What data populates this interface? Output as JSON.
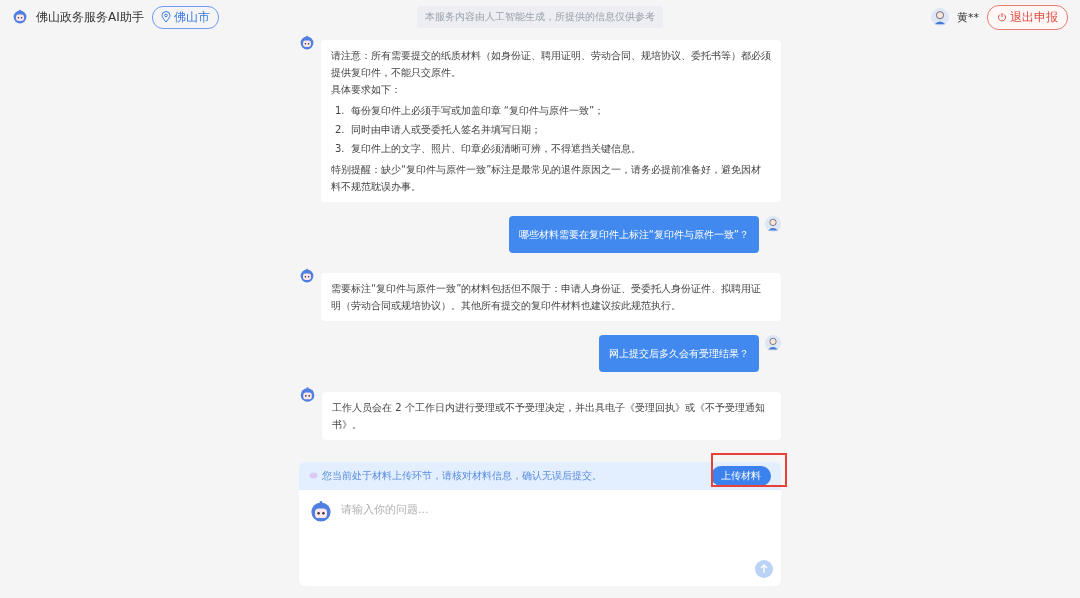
{
  "header": {
    "title": "佛山政务服务AI助手",
    "location": "佛山市",
    "notice": "本服务内容由人工智能生成，所提供的信息仅供参考",
    "user_name": "黄**",
    "exit_button": "退出申报"
  },
  "messages": [
    {
      "kind": "bot",
      "blocks": [
        {
          "kind": "text",
          "text": "请注意：所有需要提交的纸质材料（如身份证、聘用证明、劳动合同、规培协议、委托书等）都必须提供复印件，不能只交原件。"
        },
        {
          "kind": "text",
          "text": "具体要求如下："
        },
        {
          "kind": "list",
          "items": [
            {
              "marker": "1.",
              "text": "每份复印件上必须手写或加盖印章 “复印件与原件一致”；"
            },
            {
              "marker": "2.",
              "text": "同时由申请人或受委托人签名并填写日期；"
            },
            {
              "marker": "3.",
              "text": "复印件上的文字、照片、印章必须清晰可辨，不得遮挡关键信息。"
            }
          ]
        },
        {
          "kind": "text",
          "text": "特别提醒：缺少“复印件与原件一致”标注是最常见的退件原因之一，请务必提前准备好，避免因材料不规范耽误办事。"
        }
      ]
    },
    {
      "kind": "user",
      "blocks": [
        {
          "kind": "text",
          "text": "哪些材料需要在复印件上标注“复印件与原件一致”？"
        }
      ]
    },
    {
      "kind": "bot",
      "blocks": [
        {
          "kind": "text",
          "text": "需要标注“复印件与原件一致”的材料包括但不限于：申请人身份证、受委托人身份证件、拟聘用证明（劳动合同或规培协议）。其他所有提交的复印件材料也建议按此规范执行。"
        }
      ]
    },
    {
      "kind": "user",
      "blocks": [
        {
          "kind": "text",
          "text": "网上提交后多久会有受理结果？"
        }
      ]
    },
    {
      "kind": "bot",
      "blocks": [
        {
          "kind": "text",
          "text": "工作人员会在 2 个工作日内进行受理或不予受理决定，并出具电子《受理回执》或《不予受理通知书》。"
        }
      ]
    }
  ],
  "composer": {
    "hint": "您当前处于材料上传环节，请核对材料信息，确认无误后提交。",
    "upload_button": "上传材料",
    "upload_highlighted": true,
    "placeholder": "请输入你的问题..."
  }
}
